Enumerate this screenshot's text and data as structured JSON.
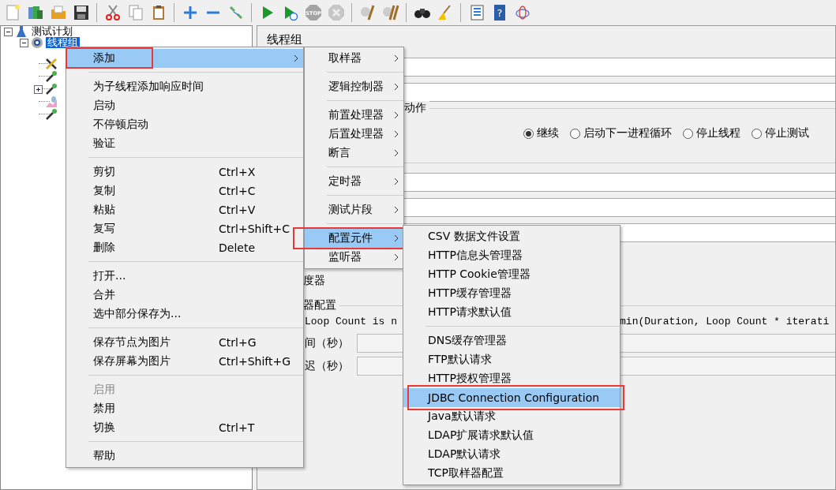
{
  "toolbar": {
    "groups": [
      [
        {
          "kind": "new",
          "disabled": false
        },
        {
          "kind": "templates",
          "disabled": false
        },
        {
          "kind": "open",
          "disabled": false
        },
        {
          "kind": "save",
          "disabled": false
        }
      ],
      [
        {
          "kind": "cut",
          "disabled": false
        },
        {
          "kind": "copy",
          "disabled": false
        },
        {
          "kind": "paste",
          "disabled": false
        }
      ],
      [
        {
          "kind": "expand",
          "disabled": false
        },
        {
          "kind": "collapse",
          "disabled": false
        },
        {
          "kind": "toggle",
          "disabled": false
        }
      ],
      [
        {
          "kind": "start",
          "disabled": false
        },
        {
          "kind": "start-no-pause",
          "disabled": false
        },
        {
          "kind": "stop",
          "label": "STOP",
          "disabled": true
        },
        {
          "kind": "shutdown",
          "disabled": true
        }
      ],
      [
        {
          "kind": "clear",
          "disabled": false
        },
        {
          "kind": "clear-all",
          "disabled": false
        }
      ],
      [
        {
          "kind": "search",
          "disabled": false
        },
        {
          "kind": "reset",
          "disabled": false
        }
      ],
      [
        {
          "kind": "list",
          "disabled": false
        },
        {
          "kind": "help",
          "label": "?",
          "disabled": false
        },
        {
          "kind": "logger",
          "disabled": false
        }
      ]
    ]
  },
  "tree": [
    {
      "label": "测试计划",
      "kind": "plan",
      "expanded": true,
      "selected": false,
      "children": [
        {
          "label": "线程组",
          "kind": "gear",
          "expanded": true,
          "selected": true,
          "children": [
            {
              "kind": "tool"
            },
            {
              "kind": "pipette"
            },
            {
              "kind": "pipette",
              "expanded": false
            },
            {
              "kind": "chart"
            },
            {
              "kind": "pipette"
            }
          ]
        }
      ]
    }
  ],
  "panel": {
    "title": "线程组",
    "action_group": {
      "legend": "动作",
      "radios": [
        {
          "label": "继续",
          "selected": true
        },
        {
          "label": "启动下一进程循环",
          "selected": false
        },
        {
          "label": "停止线程",
          "selected": false
        },
        {
          "label": "停止测试",
          "selected": false
        }
      ]
    },
    "scheduler_label": "度器",
    "scheduler_group": {
      "legend": "器配置",
      "note_left": "Loop Count is n",
      "note_right": "min(Duration, Loop Count * iterati",
      "rows": [
        {
          "label": "间（秒）"
        },
        {
          "label": "迟（秒）"
        }
      ]
    }
  },
  "context_menu": [
    {
      "kind": "item",
      "label": "添加",
      "submenu": true,
      "selected": true,
      "boxed": true
    },
    {
      "kind": "separator"
    },
    {
      "kind": "item",
      "label": "为子线程添加响应时间"
    },
    {
      "kind": "item",
      "label": "启动"
    },
    {
      "kind": "item",
      "label": "不停顿启动"
    },
    {
      "kind": "item",
      "label": "验证"
    },
    {
      "kind": "separator"
    },
    {
      "kind": "item",
      "label": "剪切",
      "shortcut": "Ctrl+X"
    },
    {
      "kind": "item",
      "label": "复制",
      "shortcut": "Ctrl+C"
    },
    {
      "kind": "item",
      "label": "粘贴",
      "shortcut": "Ctrl+V"
    },
    {
      "kind": "item",
      "label": "复写",
      "shortcut": "Ctrl+Shift+C"
    },
    {
      "kind": "item",
      "label": "删除",
      "shortcut": "Delete"
    },
    {
      "kind": "separator"
    },
    {
      "kind": "item",
      "label": "打开..."
    },
    {
      "kind": "item",
      "label": "合并"
    },
    {
      "kind": "item",
      "label": "选中部分保存为..."
    },
    {
      "kind": "separator"
    },
    {
      "kind": "item",
      "label": "保存节点为图片",
      "shortcut": "Ctrl+G"
    },
    {
      "kind": "item",
      "label": "保存屏幕为图片",
      "shortcut": "Ctrl+Shift+G"
    },
    {
      "kind": "separator"
    },
    {
      "kind": "item",
      "label": "启用",
      "disabled": true
    },
    {
      "kind": "item",
      "label": "禁用"
    },
    {
      "kind": "item",
      "label": "切换",
      "shortcut": "Ctrl+T"
    },
    {
      "kind": "separator"
    },
    {
      "kind": "item",
      "label": "帮助"
    }
  ],
  "add_submenu": [
    {
      "kind": "item",
      "label": "取样器",
      "submenu": true
    },
    {
      "kind": "separator"
    },
    {
      "kind": "item",
      "label": "逻辑控制器",
      "submenu": true
    },
    {
      "kind": "separator"
    },
    {
      "kind": "item",
      "label": "前置处理器",
      "submenu": true
    },
    {
      "kind": "item",
      "label": "后置处理器",
      "submenu": true
    },
    {
      "kind": "item",
      "label": "断言",
      "submenu": true
    },
    {
      "kind": "separator"
    },
    {
      "kind": "item",
      "label": "定时器",
      "submenu": true
    },
    {
      "kind": "separator"
    },
    {
      "kind": "item",
      "label": "测试片段",
      "submenu": true
    },
    {
      "kind": "separator"
    },
    {
      "kind": "item",
      "label": "配置元件",
      "submenu": true,
      "selected": true,
      "boxed": true
    },
    {
      "kind": "item",
      "label": "监听器",
      "submenu": true
    }
  ],
  "config_submenu": [
    {
      "kind": "item",
      "label": "CSV 数据文件设置"
    },
    {
      "kind": "item",
      "label": "HTTP信息头管理器"
    },
    {
      "kind": "item",
      "label": "HTTP Cookie管理器"
    },
    {
      "kind": "item",
      "label": "HTTP缓存管理器"
    },
    {
      "kind": "item",
      "label": "HTTP请求默认值"
    },
    {
      "kind": "separator"
    },
    {
      "kind": "item",
      "label": "DNS缓存管理器"
    },
    {
      "kind": "item",
      "label": "FTP默认请求"
    },
    {
      "kind": "item",
      "label": "HTTP授权管理器"
    },
    {
      "kind": "item",
      "label": "JDBC Connection Configuration",
      "selected": true,
      "boxed": true
    },
    {
      "kind": "item",
      "label": "Java默认请求"
    },
    {
      "kind": "item",
      "label": "LDAP扩展请求默认值"
    },
    {
      "kind": "item",
      "label": "LDAP默认请求"
    },
    {
      "kind": "item",
      "label": "TCP取样器配置"
    }
  ]
}
